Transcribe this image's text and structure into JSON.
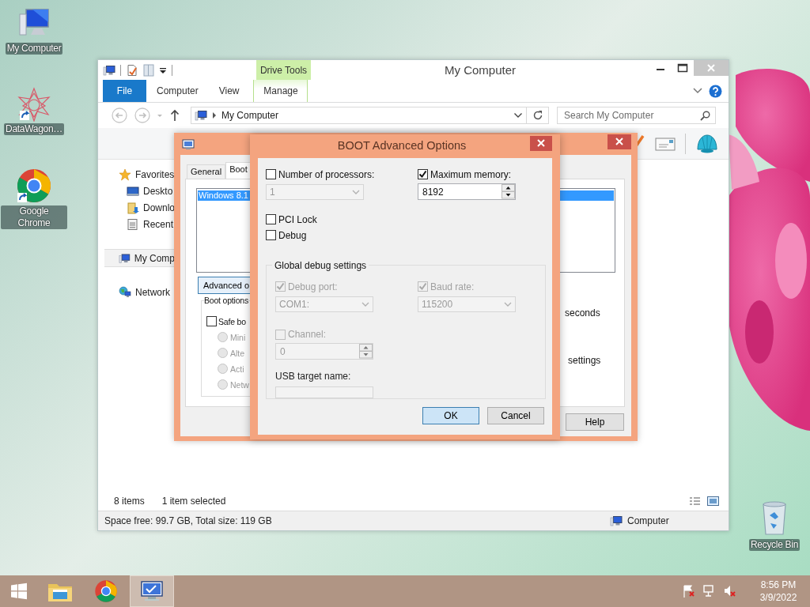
{
  "desktop_icons": [
    {
      "label": "My Computer",
      "kind": "computer"
    },
    {
      "label": "DataWagon…",
      "kind": "starburst"
    },
    {
      "label": "Google Chrome",
      "kind": "chrome"
    },
    {
      "label": "Recycle Bin",
      "kind": "bin"
    }
  ],
  "explorer": {
    "title": "My Computer",
    "contextual_group": "Drive Tools",
    "ribbon_tabs": [
      {
        "label": "File",
        "kind": "file"
      },
      {
        "label": "Computer",
        "kind": "plain"
      },
      {
        "label": "View",
        "kind": "plain"
      },
      {
        "label": "Manage",
        "kind": "contextual"
      }
    ],
    "address": "My Computer",
    "search": {
      "placeholder": "Search My Computer"
    },
    "nav": [
      {
        "label": "Favorites",
        "kind": "star",
        "selected": false,
        "children": [
          {
            "label": "Deskto",
            "kind": "desktop",
            "selected": false
          },
          {
            "label": "Downlo",
            "kind": "downloads",
            "selected": false
          },
          {
            "label": "Recent",
            "kind": "recent",
            "selected": false
          }
        ]
      },
      {
        "label": "My Comp",
        "kind": "computer",
        "selected": true
      },
      {
        "label": "Network",
        "kind": "network",
        "selected": false
      }
    ],
    "status": {
      "items": "8 items",
      "selection": "1 item selected"
    },
    "details": {
      "space": "Space free: 99.7 GB, Total size: 119 GB",
      "location": "Computer"
    }
  },
  "system_config": {
    "tabs": [
      {
        "label": "General",
        "selected": false
      },
      {
        "label": "Boot",
        "selected": true
      }
    ],
    "os_list": [
      {
        "label": "Windows 8.1",
        "selected": true
      }
    ],
    "advanced_button": "Advanced o",
    "boot_options": "Boot options",
    "safe_boot": {
      "label": "Safe bo",
      "checked": false
    },
    "safe_boot_modes": [
      {
        "label": "Mini",
        "selected": false
      },
      {
        "label": "Alte",
        "selected": false
      },
      {
        "label": "Acti",
        "selected": false
      },
      {
        "label": "Netw",
        "selected": false
      }
    ],
    "timeout_unit": "seconds",
    "make_permanent": "settings",
    "help_button": "Help"
  },
  "boot_advanced": {
    "title": "BOOT Advanced Options",
    "processors": {
      "label": "Number of processors:",
      "checked": false,
      "value": "1"
    },
    "max_memory": {
      "label": "Maximum memory:",
      "checked": true,
      "value": "8192"
    },
    "pci_lock": {
      "label": "PCI Lock",
      "checked": false
    },
    "debug": {
      "label": "Debug",
      "checked": false
    },
    "global_debug": {
      "title": "Global debug settings",
      "disabled": true,
      "debug_port": {
        "label": "Debug port:",
        "checked": true,
        "value": "COM1:"
      },
      "baud_rate": {
        "label": "Baud rate:",
        "checked": true,
        "value": "115200"
      },
      "channel": {
        "label": "Channel:",
        "checked": false,
        "value": "0"
      },
      "usb_target": {
        "label": "USB target name:"
      }
    },
    "buttons": [
      {
        "label": "OK",
        "default": true
      },
      {
        "label": "Cancel",
        "default": false
      }
    ]
  },
  "taskbar": {
    "apps": [
      {
        "kind": "explorer",
        "selected": false
      },
      {
        "kind": "chrome",
        "selected": false
      },
      {
        "kind": "msconfig",
        "selected": true
      }
    ],
    "time": "8:56 PM",
    "date": "3/9/2022"
  }
}
